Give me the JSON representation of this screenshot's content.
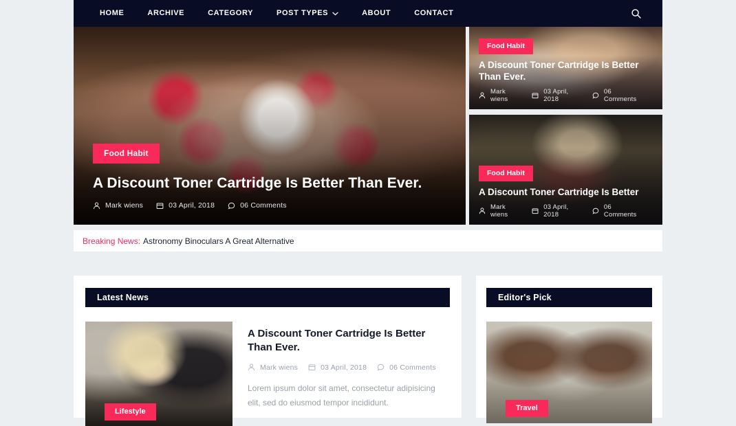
{
  "nav": {
    "items": [
      {
        "label": "HOME",
        "has_dropdown": false
      },
      {
        "label": "ARCHIVE",
        "has_dropdown": false
      },
      {
        "label": "CATEGORY",
        "has_dropdown": false
      },
      {
        "label": "POST TYPES",
        "has_dropdown": true
      },
      {
        "label": "ABOUT",
        "has_dropdown": false
      },
      {
        "label": "CONTACT",
        "has_dropdown": false
      }
    ],
    "search_icon": "search-icon",
    "dropdown_icon": "chevron-down-icon",
    "background": "#080c24"
  },
  "hero": {
    "main": {
      "badge": "Food Habit",
      "title": "A Discount Toner Cartridge Is Better Than Ever.",
      "author": "Mark wiens",
      "date": "03 April, 2018",
      "comments": "06 Comments",
      "image": "hands-holding-coffee-cup"
    },
    "side": [
      {
        "badge": "Food Habit",
        "title": "A Discount Toner Cartridge Is Better Than Ever.",
        "author": "Mark wiens",
        "date": "03 April, 2018",
        "comments": "06 Comments",
        "image": "misty-landscape"
      },
      {
        "badge": "Food Habit",
        "title": "A Discount Toner Cartridge Is Better",
        "author": "Mark wiens",
        "date": "03 April, 2018",
        "comments": "06 Comments",
        "image": "woman-in-forest"
      }
    ]
  },
  "breaking": {
    "label": "Breaking News:",
    "text": "Astronomy Binoculars A Great Alternative"
  },
  "latest_news": {
    "heading": "Latest News",
    "article": {
      "badge": "Lifestyle",
      "title": "A Discount Toner Cartridge Is Better Than Ever.",
      "author": "Mark wiens",
      "date": "03 April, 2018",
      "comments": "06 Comments",
      "excerpt": "Lorem ipsum dolor sit amet, consectetur adipisicing elit, sed do eiusmod tempor incididunt.",
      "image": "blonde-woman-leather-jacket"
    }
  },
  "editors_pick": {
    "heading": "Editor's Pick",
    "article": {
      "badge": "Travel",
      "image": "two-women-laughing"
    }
  },
  "icons": {
    "author": "user-icon",
    "date": "calendar-icon",
    "comments": "comment-icon"
  },
  "colors": {
    "accent": "#f9295a",
    "dark": "#080c24",
    "page_bg": "#eceff1",
    "panel": "#ffffff"
  }
}
